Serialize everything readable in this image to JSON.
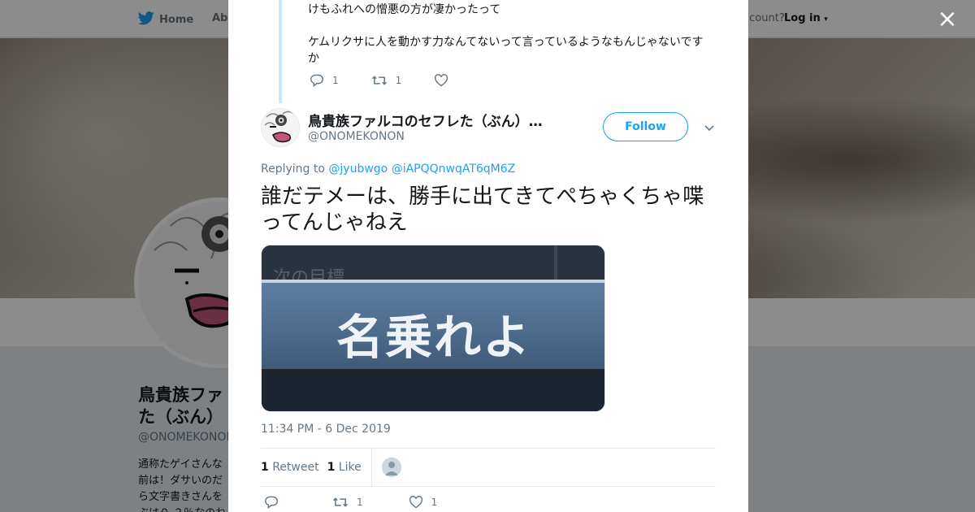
{
  "background": {
    "nav": {
      "home": "Home",
      "about": "Abo",
      "account": "ccount?",
      "login": "Log in"
    },
    "profile": {
      "name": "鳥貴族ファルコのセフレた（ぶん）…",
      "name_visible": "鳥貴族ファ\nた（ぶん）",
      "handle": "@ONOMEKONON",
      "bio": "通称たゲイさんな\n前は！ダサいのだ\nら文字書きさんを\nぶは０.２％なのね"
    }
  },
  "modal": {
    "close_label": "×",
    "parent_reply": {
      "lines": [
        "けもふれへの憎悪の方が凄かったって",
        "ケムリクサに人を動かす力なんてないって言っているようなもんじゃないですか"
      ],
      "reply_count": "1",
      "retweet_count": "1",
      "like_count": ""
    },
    "tweet": {
      "author_name": "鳥貴族ファルコのセフレた（ぶん）…",
      "author_handle": "@ONOMEKONON",
      "follow_label": "Follow",
      "replying_prefix": "Replying to",
      "replying_to": [
        "@jyubwgo",
        "@iAPQQnwqAT6qM6Z"
      ],
      "text": "誰だテメーは、勝手に出てきてぺちゃくちゃ喋ってんじゃねえ",
      "image_text": "名乗れよ",
      "image_ghost_text": "次の目標",
      "timestamp": "11:34 PM - 6 Dec 2019",
      "retweets": "1",
      "retweets_label": "Retweet",
      "likes": "1",
      "likes_label": "Like",
      "actions": {
        "reply_count": "",
        "retweet_count": "1",
        "like_count": "1"
      }
    }
  },
  "colors": {
    "accent": "#1da1f2",
    "text": "#14171a",
    "muted": "#657786",
    "thread": "#cce5f8"
  }
}
